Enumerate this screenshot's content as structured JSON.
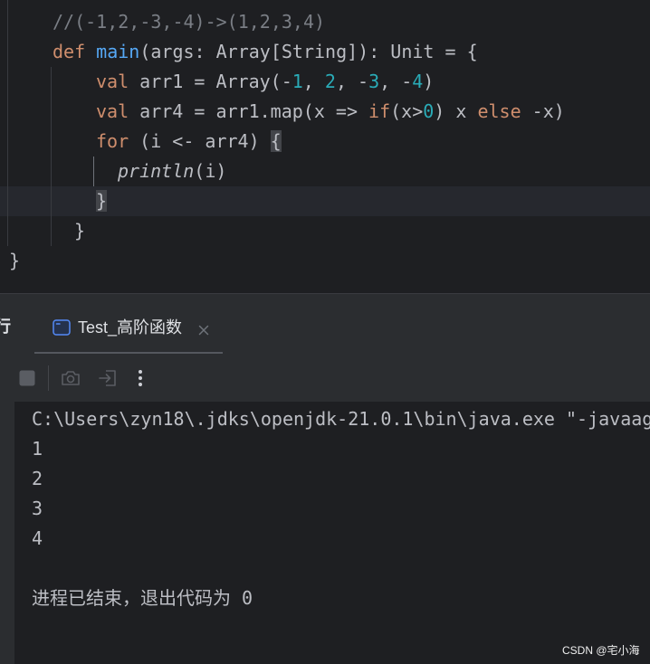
{
  "editor": {
    "lines": [
      [
        "//(-1,2,-3,-4)->(1,2,3,4)"
      ],
      [
        "def",
        " ",
        "main",
        "(args: Array[String]): Unit = {"
      ],
      [
        "val",
        " arr1 = Array(-",
        "1",
        ", ",
        "2",
        ", -",
        "3",
        ", -",
        "4",
        ")"
      ],
      [
        "val",
        " arr4 = arr1.map(x => ",
        "if",
        "(x>",
        "0",
        ") x ",
        "else",
        " -x)"
      ],
      [
        "for",
        " (i <- arr4) ",
        "{"
      ],
      [
        "println",
        "(i)"
      ],
      [
        "}"
      ],
      [
        "}"
      ],
      [
        "}"
      ]
    ]
  },
  "run_panel": {
    "title_partial": "行",
    "tab": {
      "icon": "console-icon",
      "label": "Test_高阶函数",
      "close_icon": "close-icon"
    },
    "toolbar": {
      "stop_icon": "stop-icon",
      "screenshot_icon": "camera-icon",
      "exit_icon": "exit-icon",
      "more_icon": "more-vertical-icon"
    },
    "console": {
      "lines": [
        "C:\\Users\\zyn18\\.jdks\\openjdk-21.0.1\\bin\\java.exe \"-javaag",
        "1",
        "2",
        "3",
        "4",
        "进程已结束，退出代码为 0"
      ]
    }
  },
  "watermark": "CSDN @宅小海",
  "colors": {
    "background": "#1e1f22",
    "panel": "#2b2d30",
    "text": "#bcbec4",
    "keyword": "#cf8e6d",
    "function": "#56a8f5",
    "number": "#2aacb8",
    "comment": "#7a7e85"
  }
}
